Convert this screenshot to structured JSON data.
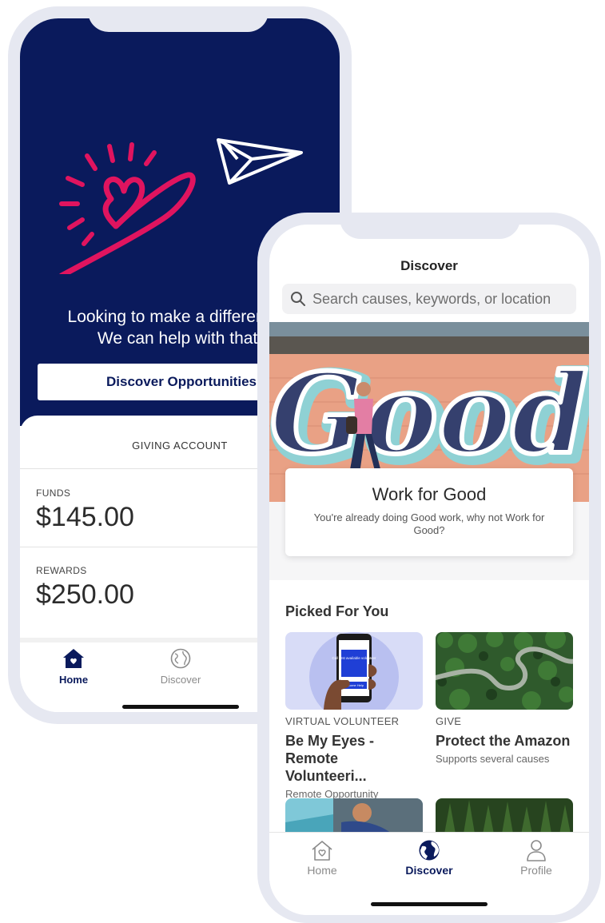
{
  "home_screen": {
    "headline_line1": "Looking to make a difference?",
    "headline_line2": "We can help with that.",
    "discover_button": "Discover Opportunities",
    "account": {
      "title": "GIVING ACCOUNT",
      "funds_label": "FUNDS",
      "funds_value": "$145.00",
      "rewards_label": "REWARDS",
      "rewards_value": "$250.00"
    },
    "tabs": [
      {
        "label": "Home",
        "icon": "house-heart-icon",
        "active": true
      },
      {
        "label": "Discover",
        "icon": "globe-icon",
        "active": false
      }
    ]
  },
  "discover_screen": {
    "title": "Discover",
    "search_placeholder": "Search causes, keywords, or location",
    "feature": {
      "mural_text": "Good",
      "title": "Work for Good",
      "subtitle": "You're already doing Good work, why not Work for Good?"
    },
    "section_title": "Picked For You",
    "opportunities": [
      {
        "kind": "VIRTUAL VOLUNTEER",
        "name_line1": "Be My Eyes -",
        "name_line2": "Remote Volunteeri...",
        "meta": "Remote Opportunity",
        "thumb_phone_text": "Call first available volunteer",
        "thumb_button_text": "Become Help"
      },
      {
        "kind": "GIVE",
        "name_line1": "Protect the Amazon",
        "name_line2": "",
        "meta": "Supports several causes"
      }
    ],
    "tabs": [
      {
        "label": "Home",
        "icon": "house-heart-icon",
        "active": false
      },
      {
        "label": "Discover",
        "icon": "globe-icon",
        "active": true
      },
      {
        "label": "Profile",
        "icon": "person-icon",
        "active": false
      }
    ]
  },
  "colors": {
    "navy": "#0a1a5c",
    "accent_pink": "#e0145f",
    "frame": "#e6e8f1",
    "inactive": "#8a8a8a"
  }
}
